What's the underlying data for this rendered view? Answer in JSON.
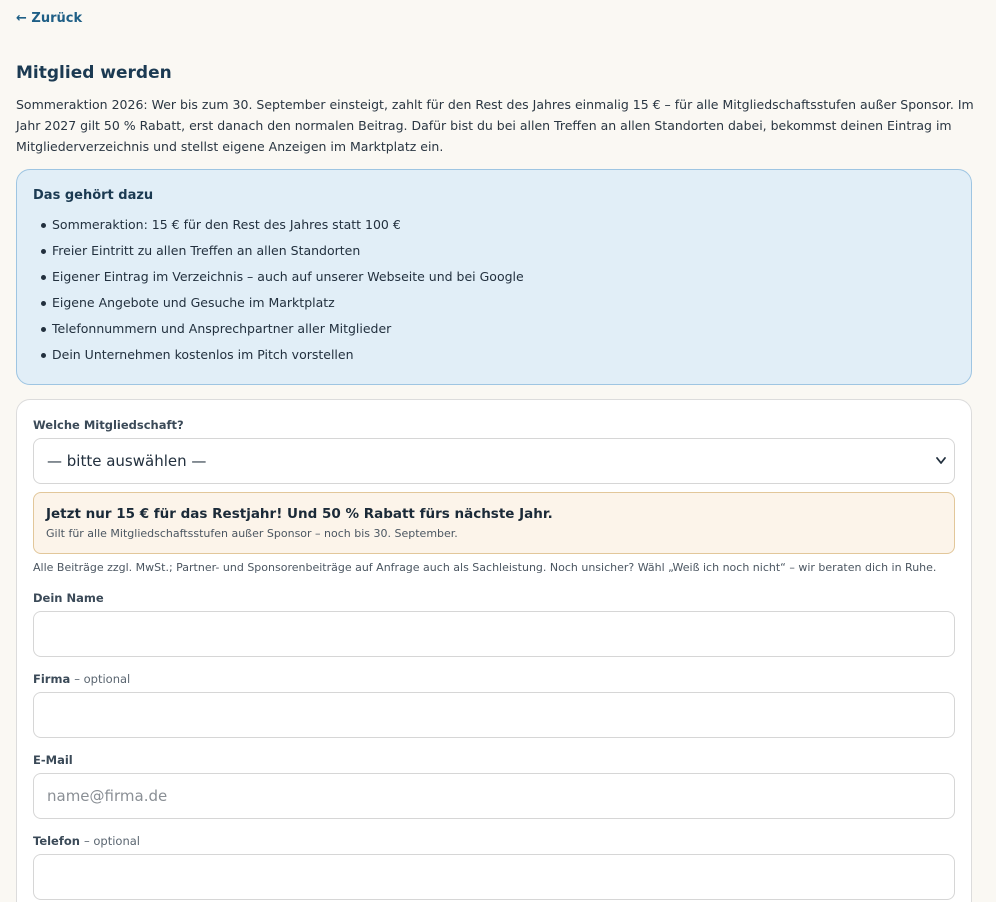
{
  "nav": {
    "back_label": "← Zurück"
  },
  "header": {
    "title": "Mitglied werden",
    "intro": "Sommeraktion 2026: Wer bis zum 30. September einsteigt, zahlt für den Rest des Jahres einmalig 15 € – für alle Mitgliedschaftsstufen außer Sponsor. Im Jahr 2027 gilt 50 % Rabatt, erst danach den normalen Beitrag. Dafür bist du bei allen Treffen an allen Standorten dabei, bekommst deinen Eintrag im Mitgliederverzeichnis und stellst eigene Anzeigen im Marktplatz ein."
  },
  "benefits": {
    "title": "Das gehört dazu",
    "items": [
      "Sommeraktion: 15 € für den Rest des Jahres statt 100 €",
      "Freier Eintritt zu allen Treffen an allen Standorten",
      "Eigener Eintrag im Verzeichnis – auch auf unserer Webseite und bei Google",
      "Eigene Angebote und Gesuche im Marktplatz",
      "Telefonnummern und Ansprechpartner aller Mitglieder",
      "Dein Unternehmen kostenlos im Pitch vorstellen"
    ]
  },
  "form": {
    "membership": {
      "label": "Welche Mitgliedschaft?",
      "selected": "— bitte auswählen —"
    },
    "promo": {
      "title": "Jetzt nur 15 € für das Restjahr! Und 50 % Rabatt fürs nächste Jahr.",
      "subtitle": "Gilt für alle Mitgliedschaftsstufen außer Sponsor – noch bis 30. September."
    },
    "hint": "Alle Beiträge zzgl. MwSt.; Partner- und Sponsorenbeiträge auf Anfrage auch als Sachleistung. Noch unsicher? Wähl „Weiß ich noch nicht“ – wir beraten dich in Ruhe.",
    "name": {
      "label": "Dein Name",
      "value": "",
      "placeholder": ""
    },
    "company": {
      "label": "Firma",
      "optional": "– optional",
      "value": "",
      "placeholder": ""
    },
    "email": {
      "label": "E-Mail",
      "value": "",
      "placeholder": "name@firma.de"
    },
    "phone": {
      "label": "Telefon",
      "optional": "– optional",
      "value": "",
      "placeholder": ""
    }
  },
  "colors": {
    "accent": "#1f5f86",
    "benefits_bg": "#e1eef7",
    "benefits_border": "#9ec5e2",
    "promo_bg": "#fcf4ea",
    "promo_border": "#e2c79a"
  },
  "icons": {
    "back": "arrow-left-icon",
    "select": "chevron-down-icon"
  }
}
